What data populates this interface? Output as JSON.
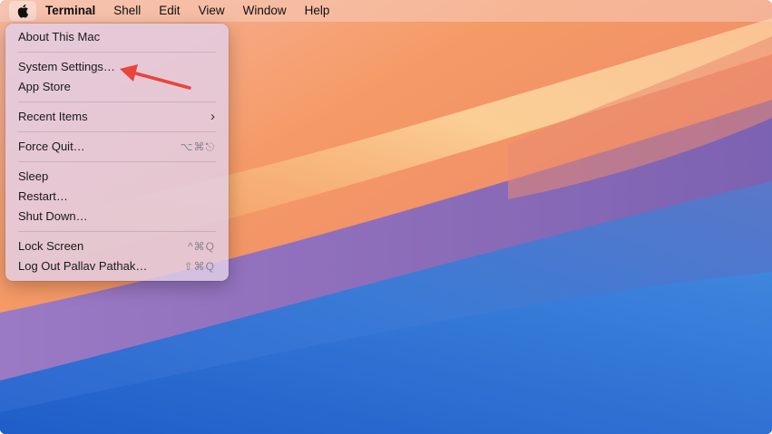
{
  "menubar": {
    "apple_icon": "apple-logo-icon",
    "items": [
      "Terminal",
      "Shell",
      "Edit",
      "View",
      "Window",
      "Help"
    ]
  },
  "apple_menu": {
    "about": "About This Mac",
    "system_settings": "System Settings…",
    "app_store": "App Store",
    "recent_items": "Recent Items",
    "force_quit": "Force Quit…",
    "force_quit_shortcut": "⌥⌘⎋",
    "sleep": "Sleep",
    "restart": "Restart…",
    "shut_down": "Shut Down…",
    "lock_screen": "Lock Screen",
    "lock_screen_shortcut": "^⌘Q",
    "log_out": "Log Out Pallav Pathak…",
    "log_out_shortcut": "⇧⌘Q"
  },
  "annotation": {
    "arrow_color": "#e8453c"
  },
  "colors": {
    "wallpaper_orange": "#f39a5c",
    "wallpaper_blue": "#2f6fd0",
    "wallpaper_purple": "#8a6bb8"
  }
}
